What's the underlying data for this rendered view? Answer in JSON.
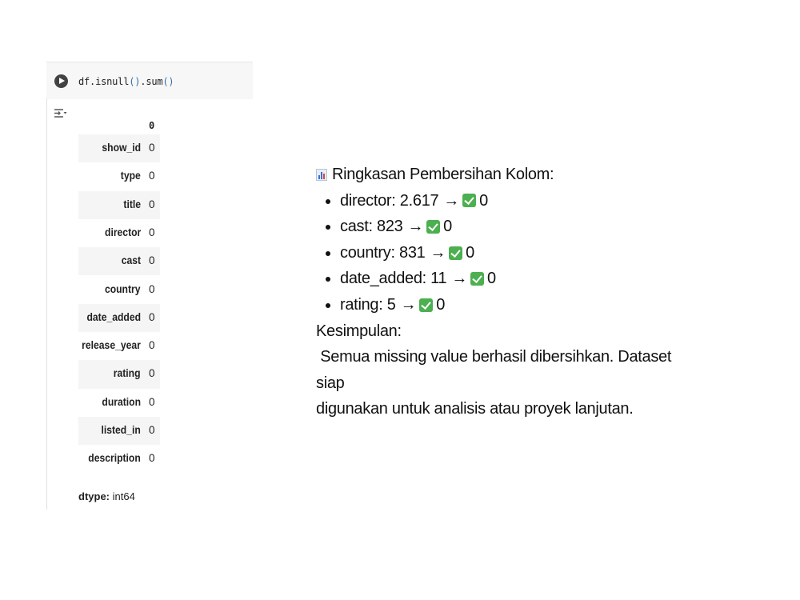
{
  "cell": {
    "code_name": "df.isnull",
    "code_paren1": "()",
    "code_method": ".sum",
    "code_paren2": "()"
  },
  "output": {
    "column_header": "0",
    "rows": [
      {
        "index": "show_id",
        "value": "0"
      },
      {
        "index": "type",
        "value": "0"
      },
      {
        "index": "title",
        "value": "0"
      },
      {
        "index": "director",
        "value": "0"
      },
      {
        "index": "cast",
        "value": "0"
      },
      {
        "index": "country",
        "value": "0"
      },
      {
        "index": "date_added",
        "value": "0"
      },
      {
        "index": "release_year",
        "value": "0"
      },
      {
        "index": "rating",
        "value": "0"
      },
      {
        "index": "duration",
        "value": "0"
      },
      {
        "index": "listed_in",
        "value": "0"
      },
      {
        "index": "description",
        "value": "0"
      }
    ],
    "dtype_label": "dtype:",
    "dtype_value": " int64"
  },
  "summary": {
    "title": "Ringkasan Pembersihan Kolom:",
    "arrow": "→",
    "items": [
      {
        "label": "director: 2.617",
        "after": "0"
      },
      {
        "label": "cast: 823",
        "after": "0"
      },
      {
        "label": "country: 831",
        "after": "0"
      },
      {
        "label": "date_added: 11",
        "after": "0"
      },
      {
        "label": "rating: 5",
        "after": "0"
      }
    ],
    "conclusion_heading": "Kesimpulan:",
    "conclusion_line1": " Semua missing value berhasil dibersihkan. Dataset siap",
    "conclusion_line2": "digunakan untuk analisis atau proyek lanjutan."
  },
  "icons": {
    "run": "play-circle-icon",
    "output": "output-toggle-icon",
    "chart": "bar-chart-icon",
    "check": "check-mark-icon"
  },
  "colors": {
    "check_green": "#4caf50",
    "paren_blue": "#3a6ea8"
  }
}
